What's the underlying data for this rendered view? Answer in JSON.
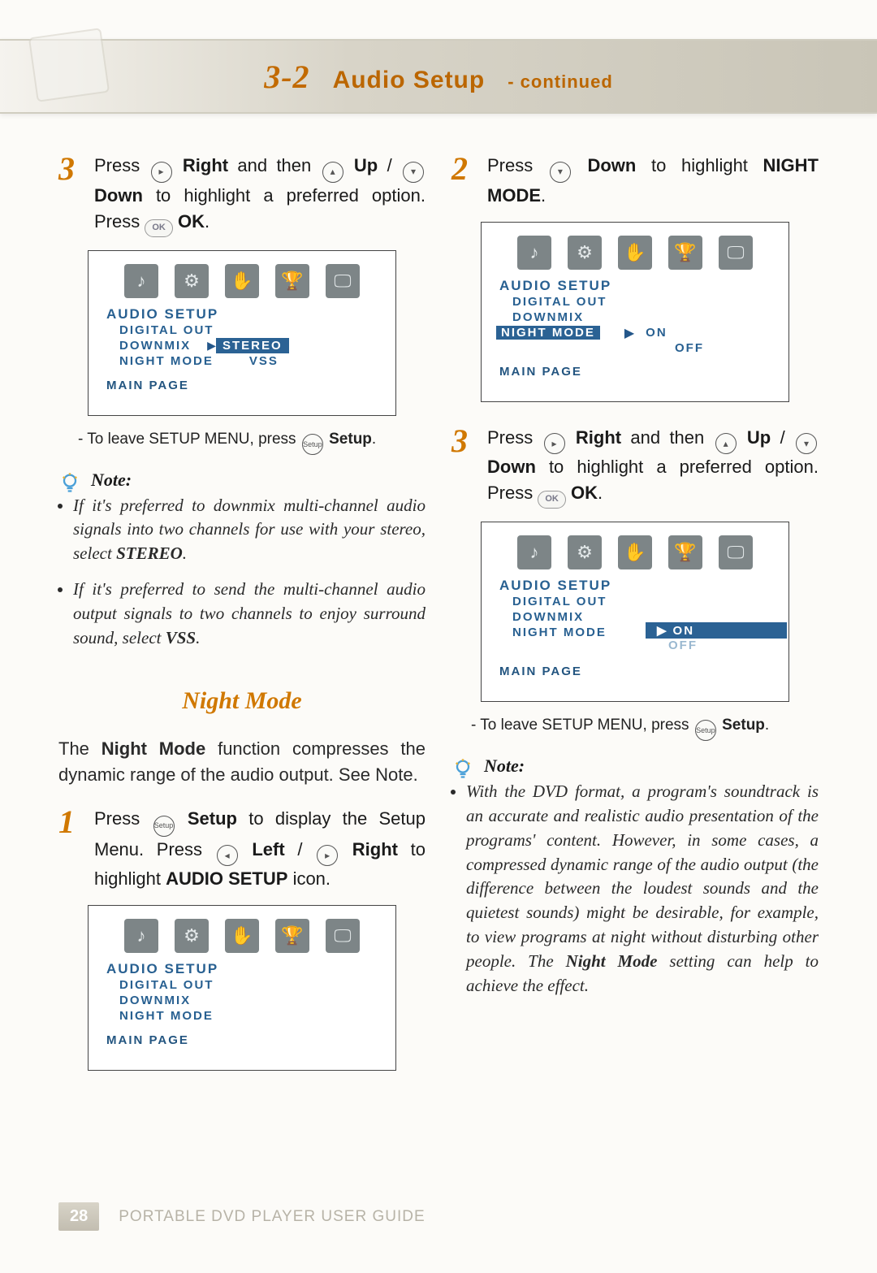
{
  "header": {
    "num": "3-2",
    "label": "Audio Setup",
    "sub": "- continued"
  },
  "buttons": {
    "ok_label": "OK",
    "setup_label": "Setup"
  },
  "left": {
    "step3": {
      "press": "Press ",
      "right": "Right",
      "andthen": " and then ",
      "up": "Up",
      "slash": " / ",
      "down": "Down",
      "to": " to highlight a preferred option. Press ",
      "ok": "OK",
      "period": "."
    },
    "osd1": {
      "title": "AUDIO SETUP",
      "items": [
        "DIGITAL OUT",
        "DOWNMIX",
        "NIGHT MODE"
      ],
      "main": "MAIN PAGE",
      "opts": [
        "STEREO",
        "VSS"
      ]
    },
    "leave": "- To leave SETUP MENU, press ",
    "leave_b": "Setup",
    "note_head": "Note:",
    "notes": [
      "If it's preferred to downmix multi-channel audio signals into two channels for use with your stereo, select <b>STEREO</b>.",
      "If it's preferred to send the multi-channel audio output signals to two channels to enjoy surround sound, select <b>VSS</b>."
    ],
    "nm_heading": "Night Mode",
    "nm_intro1": "The ",
    "nm_intro_b": "Night Mode",
    "nm_intro2": " function compresses the dynamic range of the audio output. See Note.",
    "step1": {
      "press": "Press ",
      "setup": "Setup",
      "to": " to display the Setup Menu. Press ",
      "left": "Left",
      "slash": " / ",
      "right": "Right",
      "to2": " to highlight ",
      "audio": "AUDIO SETUP",
      "icon": " icon."
    },
    "osd_plain": {
      "title": "AUDIO SETUP",
      "items": [
        "DIGITAL OUT",
        "DOWNMIX",
        "NIGHT MODE"
      ],
      "main": "MAIN PAGE"
    }
  },
  "right": {
    "step2": {
      "press": "Press ",
      "down": "Down",
      "to": " to highlight ",
      "nm": "NIGHT MODE",
      "period": "."
    },
    "osd2": {
      "title": "AUDIO SETUP",
      "items": [
        "DIGITAL OUT",
        "DOWNMIX"
      ],
      "hl": "NIGHT MODE",
      "main": "MAIN PAGE",
      "opts": [
        "ON",
        "OFF"
      ]
    },
    "step3": {
      "press": "Press ",
      "right": "Right",
      "andthen": " and then ",
      "up": "Up",
      "slash": " / ",
      "down": "Down",
      "to": " to highlight a preferred option. Press ",
      "ok": "OK",
      "period": "."
    },
    "osd3": {
      "title": "AUDIO SETUP",
      "items": [
        "DIGITAL OUT",
        "DOWNMIX",
        "NIGHT MODE"
      ],
      "main": "MAIN PAGE",
      "opt_on": "ON",
      "opt_off": "OFF"
    },
    "leave": "- To leave SETUP MENU, press ",
    "leave_b": "Setup",
    "note_head": "Note:",
    "note_body": "With the DVD format, a program's soundtrack is an accurate and realistic audio presentation of the programs' content. However, in some cases, a compressed dynamic range of the audio output (the difference between the loudest sounds and the quietest sounds) might be desirable, for example, to view programs at night without disturbing other people. The <b>Night Mode</b> setting can help to achieve the effect."
  },
  "footer": {
    "page": "28",
    "text": "PORTABLE DVD PLAYER USER GUIDE"
  }
}
